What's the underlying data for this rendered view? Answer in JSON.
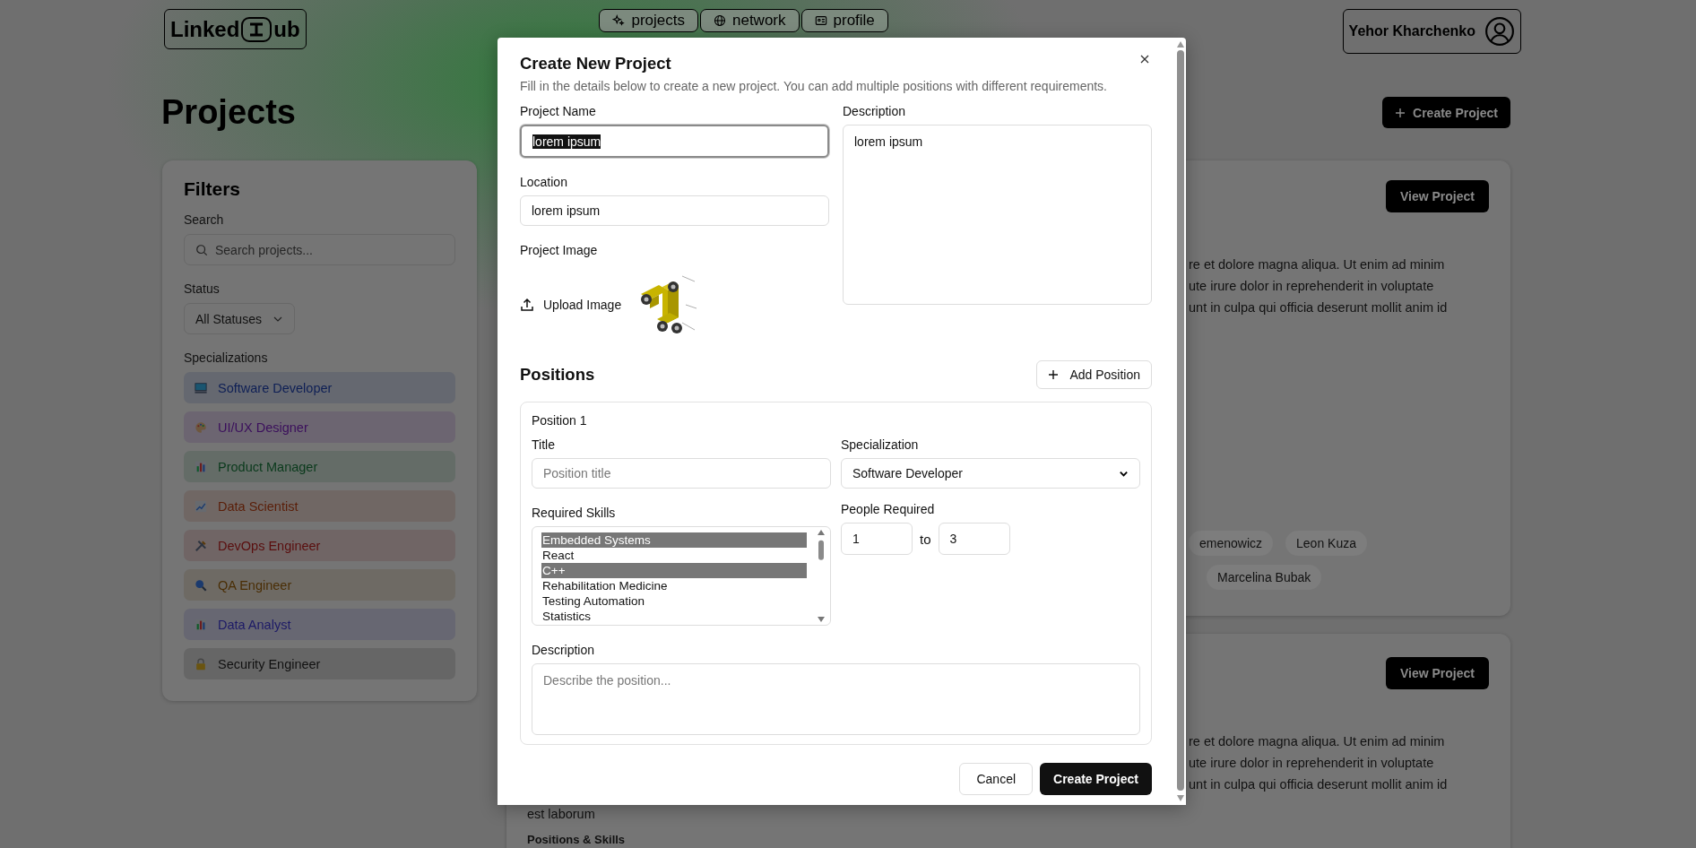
{
  "header": {
    "logo": {
      "left": "Linked",
      "right": "ub"
    },
    "nav": [
      {
        "label": "projects"
      },
      {
        "label": "network"
      },
      {
        "label": "profile"
      }
    ],
    "user": {
      "name": "Yehor Kharchenko"
    }
  },
  "page": {
    "title": "Projects",
    "create_button": "Create Project"
  },
  "filters": {
    "title": "Filters",
    "search_label": "Search",
    "search_placeholder": "Search projects...",
    "status_label": "Status",
    "status_value": "All Statuses",
    "specializations_label": "Specializations",
    "specializations": [
      {
        "label": "Software Developer",
        "color": "#0e1f55"
      },
      {
        "label": "UI/UX Designer",
        "color": "#3b0f5c"
      },
      {
        "label": "Product Manager",
        "color": "#0a3a1c"
      },
      {
        "label": "Data Scientist",
        "color": "#5a1e08"
      },
      {
        "label": "DevOps Engineer",
        "color": "#5a0e0e"
      },
      {
        "label": "QA Engineer",
        "color": "#4a2e05"
      },
      {
        "label": "Data Analyst",
        "color": "#1d1a66"
      },
      {
        "label": "Security Engineer",
        "color": "#111111"
      }
    ]
  },
  "projects": [
    {
      "button": "View Project",
      "text_lines": [
        "re et dolore magna aliqua. Ut enim ad minim",
        "ute irure dolor in reprehenderit in voluptate",
        "unt in culpa qui officia deserunt mollit anim id"
      ],
      "tags": [
        [
          "emenowicz",
          "Leon Kuza"
        ],
        [
          "Marcelina Bubak"
        ]
      ]
    },
    {
      "button": "View Project",
      "text_lines": [
        "re et dolore magna aliqua. Ut enim ad minim",
        "ute irure dolor in reprehenderit in voluptate",
        "unt in culpa qui officia deserunt mollit anim id"
      ],
      "footer_text": "est laborum",
      "section_title": "Positions & Skills"
    }
  ],
  "modal": {
    "title": "Create New Project",
    "subtitle": "Fill in the details below to create a new project. You can add multiple positions with different requirements.",
    "name_label": "Project Name",
    "name_value": "lorem ipsum",
    "name_text_selected": true,
    "location_label": "Location",
    "location_value": "lorem ipsum",
    "image_label": "Project Image",
    "upload_button": "Upload Image",
    "description_label": "Description",
    "description_value": "lorem ipsum",
    "positions_title": "Positions",
    "add_button": "Add Position",
    "positions": [
      {
        "heading": "Position 1",
        "title_label": "Title",
        "title_placeholder": "Position title",
        "specialization_label": "Specialization",
        "specialization_value": "Software Developer",
        "skills_label": "Required Skills",
        "skills": [
          {
            "label": "Embedded Systems",
            "selected": true
          },
          {
            "label": "React",
            "selected": false
          },
          {
            "label": "C++",
            "selected": true
          },
          {
            "label": "Rehabilitation Medicine",
            "selected": false
          },
          {
            "label": "Testing Automation",
            "selected": false
          },
          {
            "label": "Statistics",
            "selected": false
          }
        ],
        "people_label": "People Required",
        "min": "1",
        "separator": "to",
        "max": "3",
        "description_label": "Description",
        "description_placeholder": "Describe the position..."
      }
    ],
    "cancel_button": "Cancel",
    "submit_button": "Create Project"
  }
}
